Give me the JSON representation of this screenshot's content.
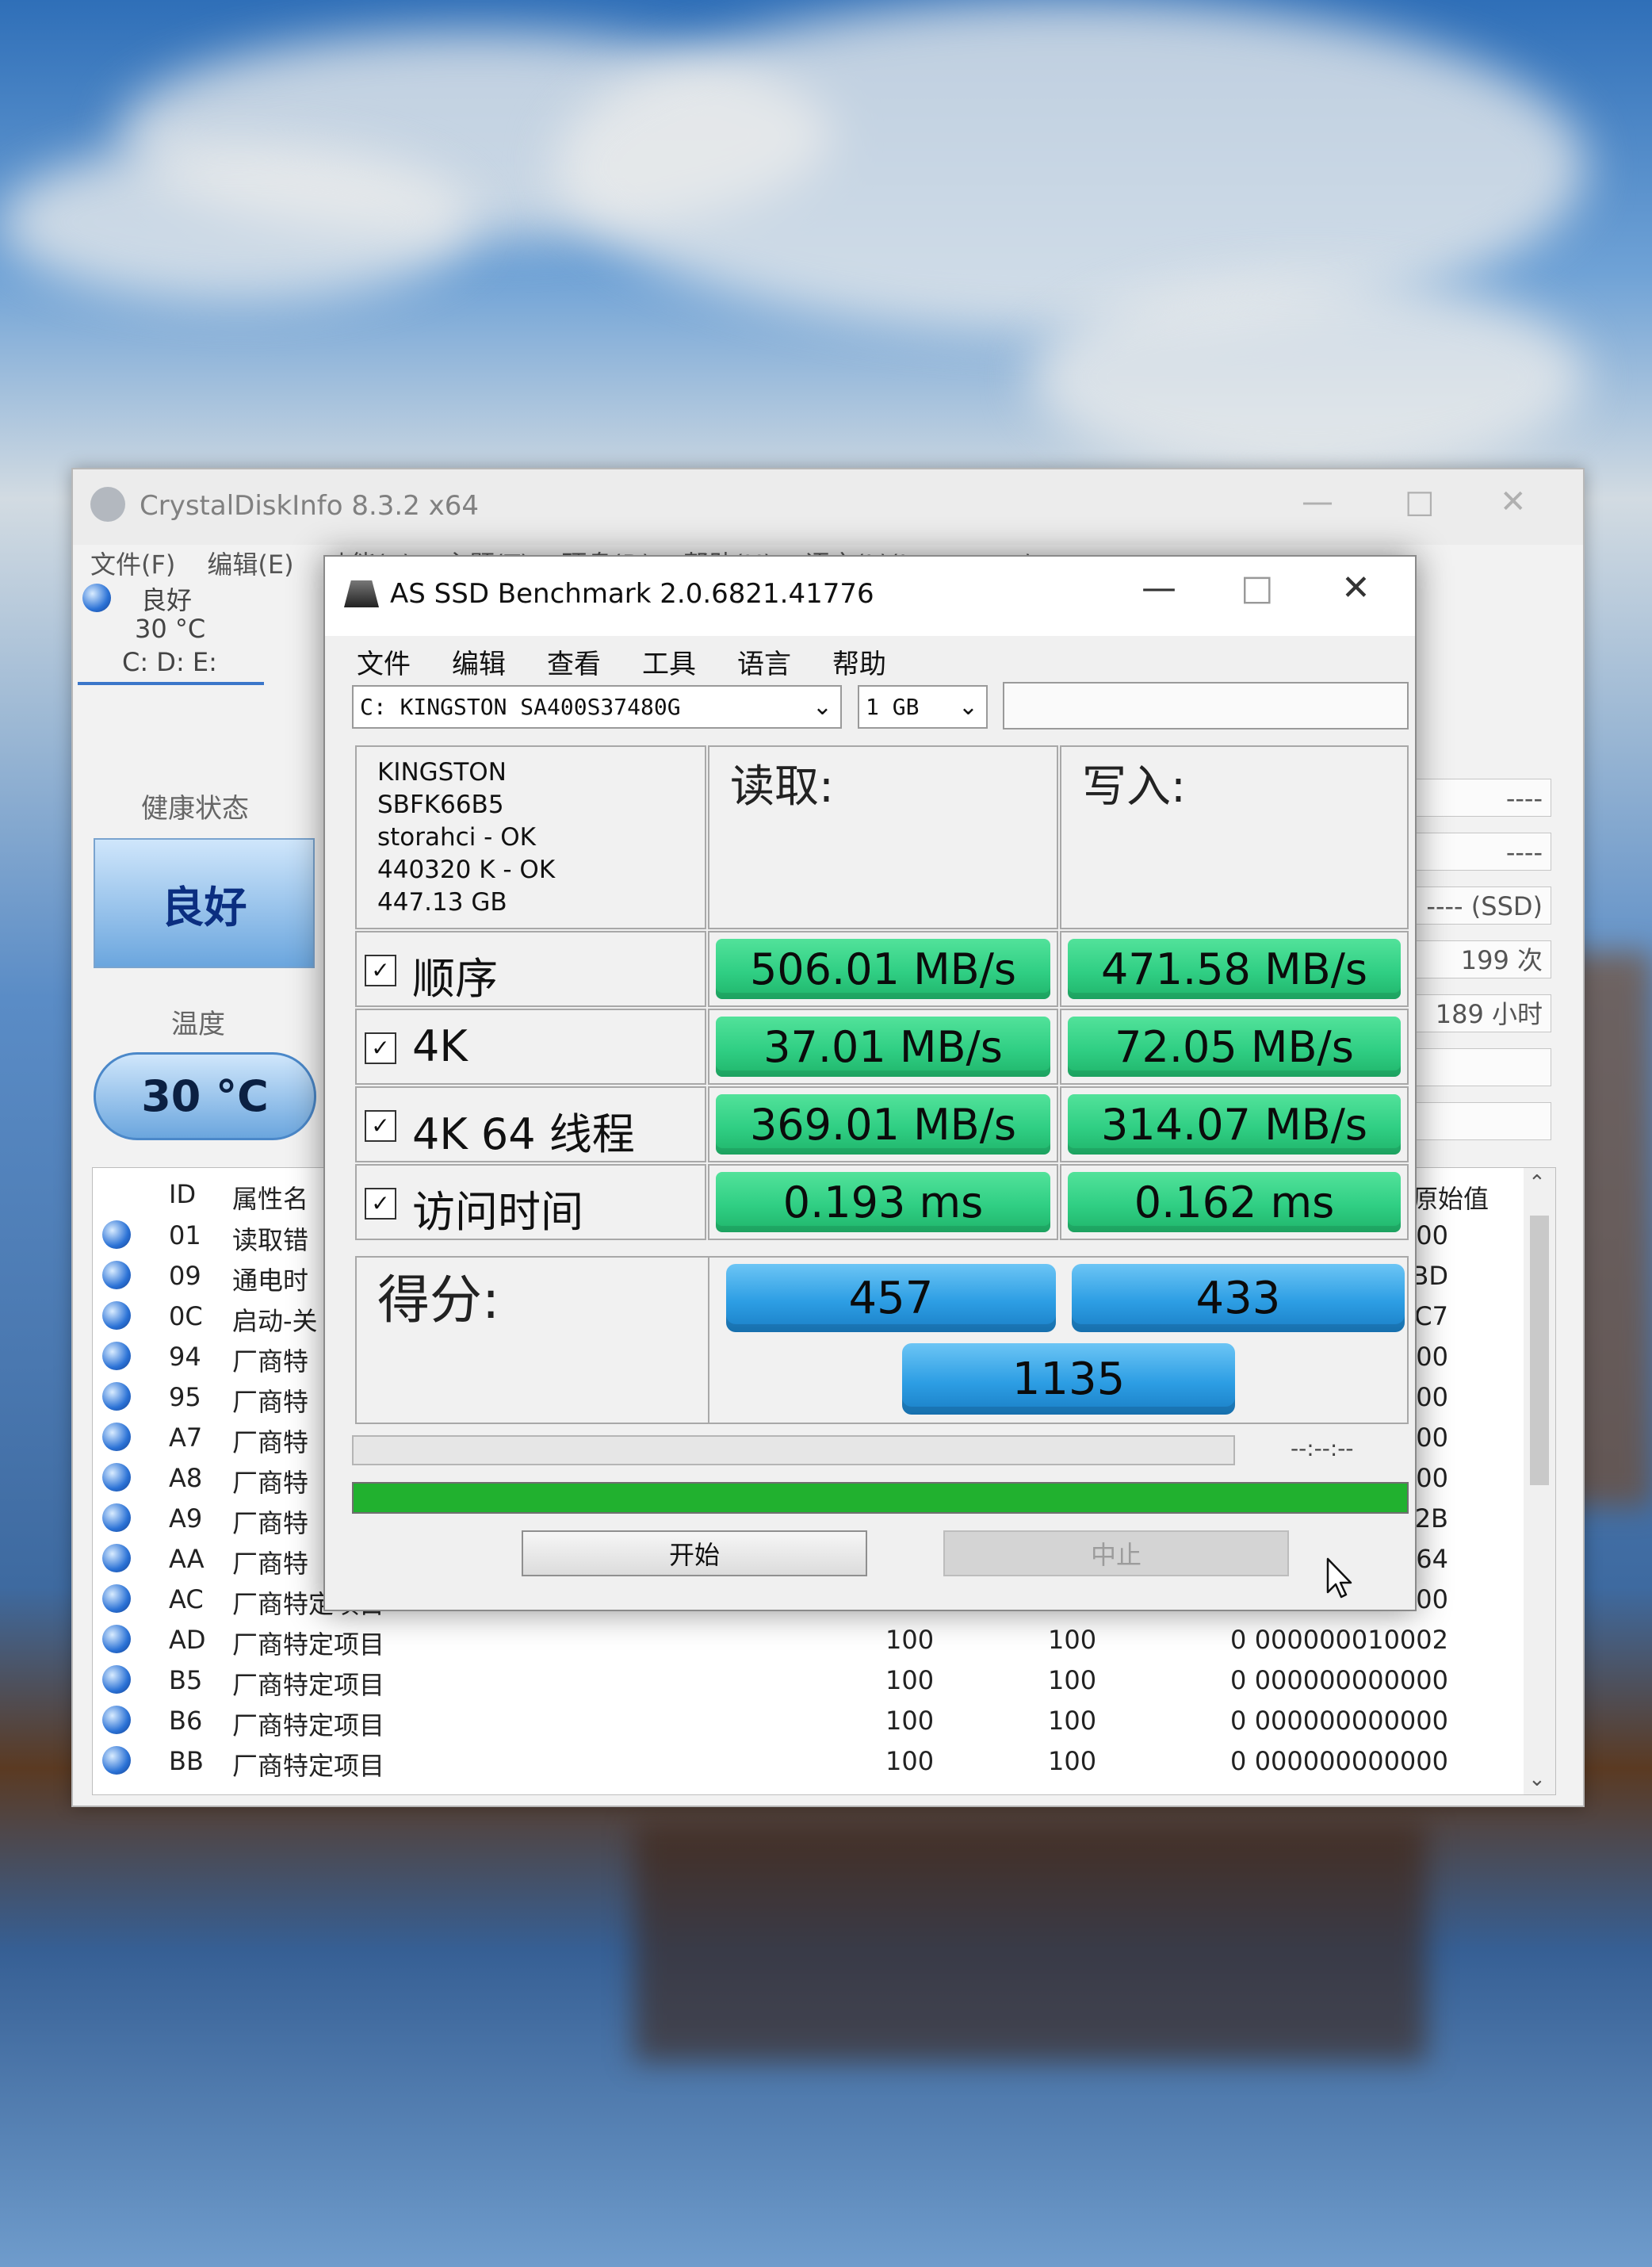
{
  "cdi": {
    "title": "CrystalDiskInfo 8.3.2 x64",
    "menu": [
      "文件(F)",
      "编辑(E)",
      "功能(u)",
      "主题(T)",
      "硬盘(D)",
      "帮助(H)",
      "语言(L)(Language)"
    ],
    "disk_status": "良好",
    "disk_temp": "30 °C",
    "disk_letters": "C: D: E:",
    "health_label": "健康状态",
    "health_value": "良好",
    "temp_label": "温度",
    "temp_value": "30 °C",
    "info_boxes": [
      "----",
      "----",
      "---- (SSD)",
      "199 次",
      "189 小时"
    ],
    "table": {
      "head_id": "ID",
      "head_name": "属性名",
      "head_raw": "原始值",
      "rows": [
        {
          "id": "01",
          "name": "读取错",
          "cur": "",
          "worst": "",
          "thresh": "",
          "raw": "00000"
        },
        {
          "id": "09",
          "name": "通电时",
          "cur": "",
          "worst": "",
          "thresh": "",
          "raw": "000BD"
        },
        {
          "id": "0C",
          "name": "启动-关",
          "cur": "",
          "worst": "",
          "thresh": "",
          "raw": "000C7"
        },
        {
          "id": "94",
          "name": "厂商特",
          "cur": "",
          "worst": "",
          "thresh": "",
          "raw": "00000"
        },
        {
          "id": "95",
          "name": "厂商特",
          "cur": "",
          "worst": "",
          "thresh": "",
          "raw": "00000"
        },
        {
          "id": "A7",
          "name": "厂商特",
          "cur": "",
          "worst": "",
          "thresh": "",
          "raw": "00000"
        },
        {
          "id": "A8",
          "name": "厂商特",
          "cur": "",
          "worst": "",
          "thresh": "",
          "raw": "00000"
        },
        {
          "id": "A9",
          "name": "厂商特",
          "cur": "",
          "worst": "",
          "thresh": "",
          "raw": "0002B"
        },
        {
          "id": "AA",
          "name": "厂商特",
          "cur": "",
          "worst": "",
          "thresh": "",
          "raw": "00064"
        },
        {
          "id": "AC",
          "name": "厂商特定项目",
          "cur": "100",
          "worst": "100",
          "thresh": "0",
          "raw": "000000000000"
        },
        {
          "id": "AD",
          "name": "厂商特定项目",
          "cur": "100",
          "worst": "100",
          "thresh": "0",
          "raw": "000000010002"
        },
        {
          "id": "B5",
          "name": "厂商特定项目",
          "cur": "100",
          "worst": "100",
          "thresh": "0",
          "raw": "000000000000"
        },
        {
          "id": "B6",
          "name": "厂商特定项目",
          "cur": "100",
          "worst": "100",
          "thresh": "0",
          "raw": "000000000000"
        },
        {
          "id": "BB",
          "name": "厂商特定项目",
          "cur": "100",
          "worst": "100",
          "thresh": "0",
          "raw": "000000000000"
        }
      ]
    }
  },
  "asssd": {
    "title": "AS SSD Benchmark 2.0.6821.41776",
    "menu": [
      "文件",
      "编辑",
      "查看",
      "工具",
      "语言",
      "帮助"
    ],
    "drive_select": "C: KINGSTON SA400S37480G",
    "size_select": "1 GB",
    "info": [
      "KINGSTON",
      "SBFK66B5",
      "storahci - OK",
      "440320 K - OK",
      "447.13 GB"
    ],
    "read_header": "读取:",
    "write_header": "写入:",
    "rows": [
      {
        "label": "顺序",
        "read": "506.01 MB/s",
        "write": "471.58 MB/s"
      },
      {
        "label": "4K",
        "read": "37.01 MB/s",
        "write": "72.05 MB/s"
      },
      {
        "label": "4K 64 线程",
        "read": "369.01 MB/s",
        "write": "314.07 MB/s"
      },
      {
        "label": "访问时间",
        "read": "0.193 ms",
        "write": "0.162 ms"
      }
    ],
    "score_label": "得分:",
    "score_read": "457",
    "score_write": "433",
    "score_total": "1135",
    "time_display": "--:--:--",
    "progress_fraction": 1.0,
    "start_button": "开始",
    "stop_button": "中止"
  }
}
